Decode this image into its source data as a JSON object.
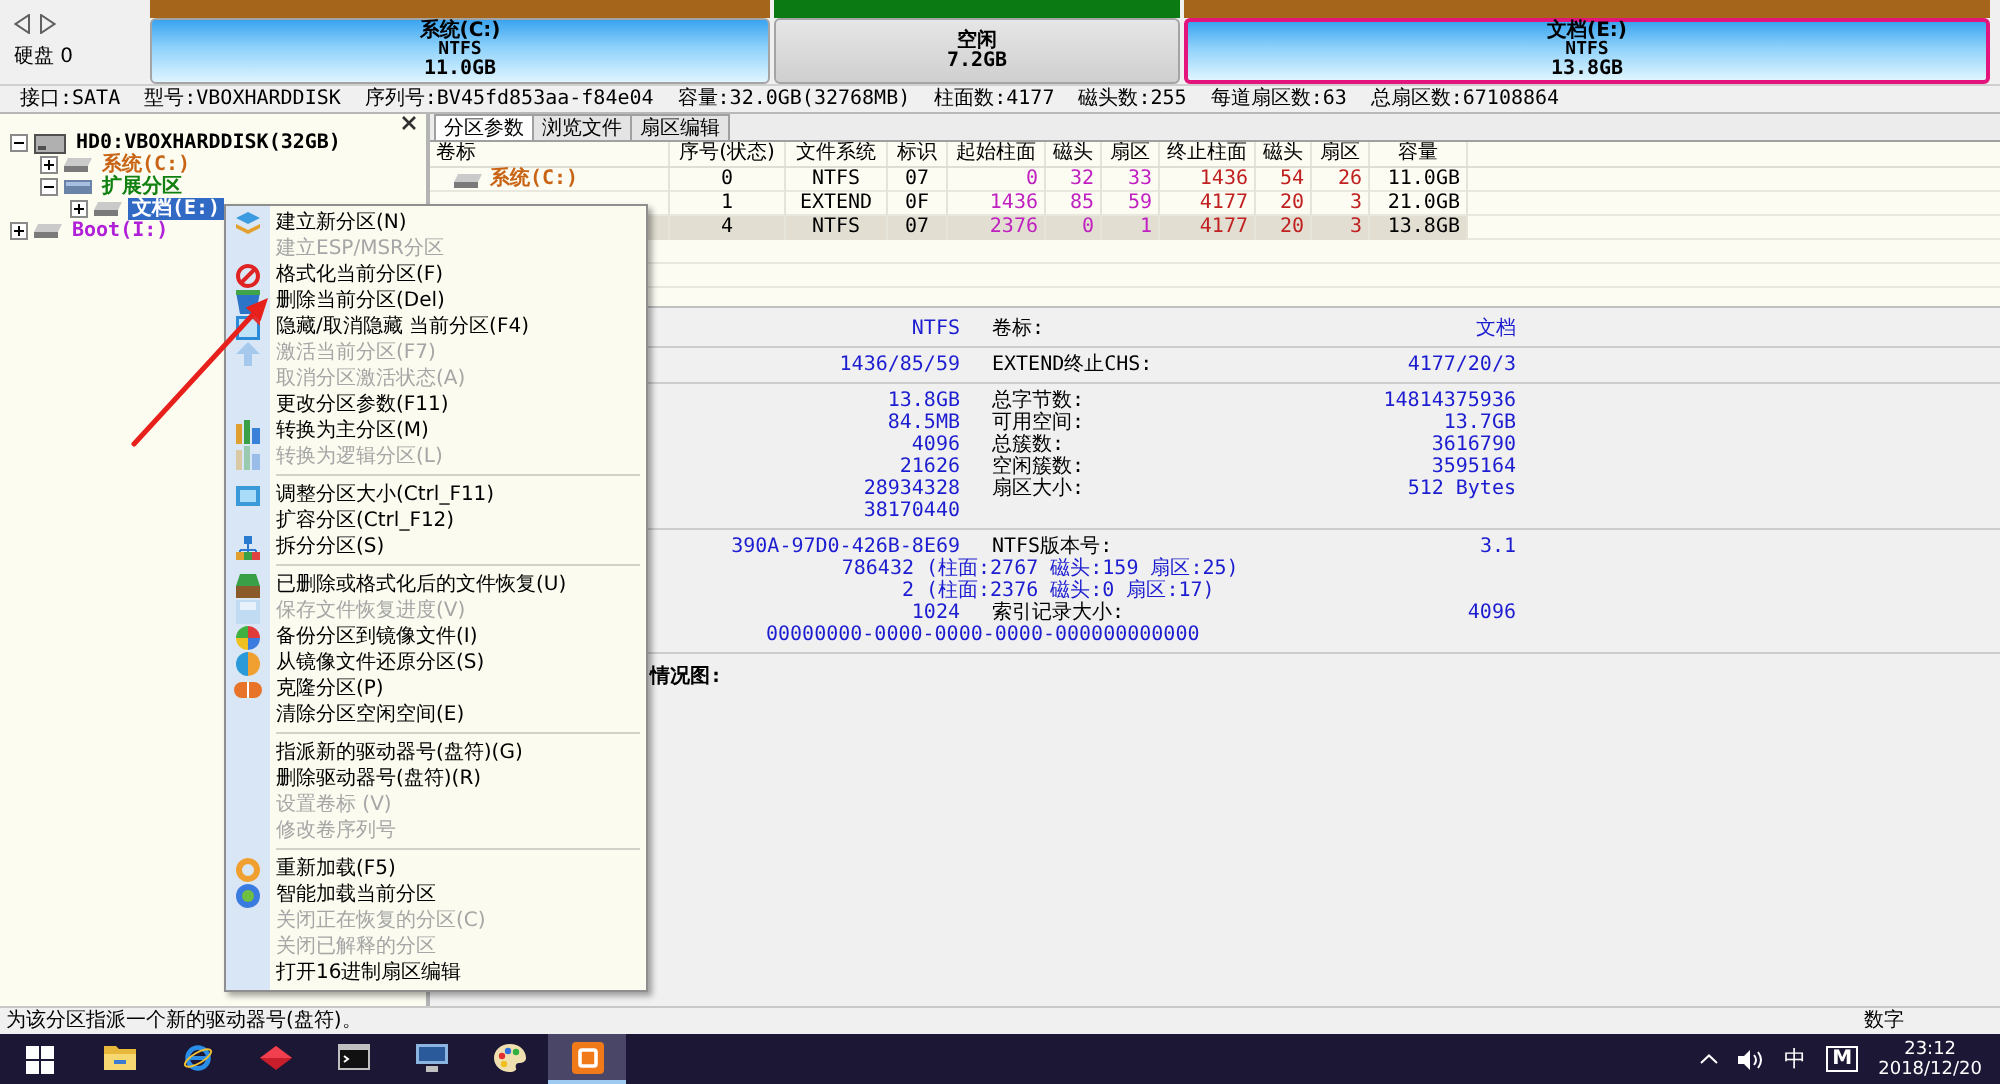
{
  "disk_nav": {
    "label": "硬盘 0"
  },
  "disk_map": [
    {
      "kind": "partition",
      "name": "系统(C:)",
      "filesystem": "NTFS",
      "size": "11.0GB",
      "selected": false
    },
    {
      "kind": "free",
      "name": "空闲",
      "size": "7.2GB",
      "selected": false
    },
    {
      "kind": "partition",
      "name": "文档(E:)",
      "filesystem": "NTFS",
      "size": "13.8GB",
      "selected": true
    }
  ],
  "disk_info": [
    "接口:SATA",
    "型号:VBOXHARDDISK",
    "序列号:BV45fd853aa-f84e04",
    "容量:32.0GB(32768MB)",
    "柱面数:4177",
    "磁头数:255",
    "每道扇区数:63",
    "总扇区数:67108864"
  ],
  "tree": [
    {
      "kind": "disk",
      "label": "HD0:VBOXHARDDISK(32GB)",
      "expanded": true,
      "selected": false,
      "children": [
        {
          "kind": "partition",
          "label": "系统(C:)",
          "color": "#c86414",
          "expanded": false,
          "selected": false
        },
        {
          "kind": "extended",
          "label": "扩展分区",
          "color": "#108010",
          "expanded": true,
          "selected": false,
          "children": [
            {
              "kind": "partition",
              "label": "文档(E:)",
              "expanded": false,
              "selected": true
            }
          ]
        }
      ]
    },
    {
      "kind": "partition",
      "label": "Boot(I:)",
      "color": "#b020d8",
      "expanded": false,
      "selected": false
    }
  ],
  "tabs": [
    {
      "label": "分区参数",
      "selected": true
    },
    {
      "label": "浏览文件",
      "selected": false
    },
    {
      "label": "扇区编辑",
      "selected": false
    }
  ],
  "table": {
    "columns": [
      "卷标",
      "序号(状态)",
      "文件系统",
      "标识",
      "起始柱面",
      "磁头",
      "扇区",
      "终止柱面",
      "磁头",
      "扇区",
      "容量"
    ],
    "rows": [
      {
        "color": "#c86414",
        "selected": false,
        "cells": [
          "系统(C:)",
          "0",
          "NTFS",
          "07",
          "0",
          "32",
          "33",
          "1436",
          "54",
          "26",
          "11.0GB"
        ]
      },
      {
        "selected": false,
        "cells": [
          "",
          "1",
          "EXTEND",
          "0F",
          "1436",
          "85",
          "59",
          "4177",
          "20",
          "3",
          "21.0GB"
        ]
      },
      {
        "selected": true,
        "cells": [
          "",
          "4",
          "NTFS",
          "07",
          "2376",
          "0",
          "1",
          "4177",
          "20",
          "3",
          "13.8GB"
        ]
      }
    ]
  },
  "details": {
    "groups": [
      [
        {
          "kind": "pair",
          "value": "NTFS",
          "label": "卷标:",
          "label_value": "文档"
        }
      ],
      [
        {
          "kind": "pair",
          "value": "1436/85/59",
          "label": "EXTEND终止CHS:",
          "label_value": "4177/20/3"
        }
      ],
      [
        {
          "kind": "pair",
          "value": "13.8GB",
          "label": "总字节数:",
          "label_value": "14814375936"
        },
        {
          "kind": "pair",
          "value": "84.5MB",
          "label": "可用空间:",
          "label_value": "13.7GB"
        },
        {
          "kind": "pair",
          "value": "4096",
          "label": "总簇数:",
          "label_value": "3616790"
        },
        {
          "kind": "pair",
          "value": "21626",
          "label": "空闲簇数:",
          "label_value": "3595164"
        },
        {
          "kind": "pair",
          "value": "28934328",
          "label": "扇区大小:",
          "label_value": "512 Bytes"
        },
        {
          "kind": "value",
          "value": "38170440"
        }
      ],
      [
        {
          "kind": "pair",
          "value": "390A-97D0-426B-8E69",
          "label": "NTFS版本号:",
          "label_value": "3.1"
        },
        {
          "kind": "split",
          "value": "786432",
          "extra": "(柱面:2767 磁头:159 扇区:25)"
        },
        {
          "kind": "split",
          "value": "2",
          "extra": "(柱面:2376 磁头:0 扇区:17)"
        },
        {
          "kind": "pair",
          "value": "1024",
          "label": "索引记录大小:",
          "label_value": "4096"
        },
        {
          "kind": "wide",
          "value": "00000000-0000-0000-0000-000000000000"
        }
      ]
    ],
    "map_label": "情况图:"
  },
  "menu": [
    {
      "kind": "item",
      "label": "建立新分区(N)",
      "disabled": false
    },
    {
      "kind": "item",
      "label": "建立ESP/MSR分区",
      "disabled": true
    },
    {
      "kind": "item",
      "label": "格式化当前分区(F)",
      "disabled": false
    },
    {
      "kind": "item",
      "label": "删除当前分区(Del)",
      "disabled": false
    },
    {
      "kind": "item",
      "label": "隐藏/取消隐藏 当前分区(F4)",
      "disabled": false
    },
    {
      "kind": "item",
      "label": "激活当前分区(F7)",
      "disabled": true
    },
    {
      "kind": "item",
      "label": "取消分区激活状态(A)",
      "disabled": true
    },
    {
      "kind": "item",
      "label": "更改分区参数(F11)",
      "disabled": false
    },
    {
      "kind": "item",
      "label": "转换为主分区(M)",
      "disabled": false
    },
    {
      "kind": "item",
      "label": "转换为逻辑分区(L)",
      "disabled": true
    },
    {
      "kind": "separator"
    },
    {
      "kind": "item",
      "label": "调整分区大小(Ctrl_F11)",
      "disabled": false
    },
    {
      "kind": "item",
      "label": "扩容分区(Ctrl_F12)",
      "disabled": false
    },
    {
      "kind": "item",
      "label": "拆分分区(S)",
      "disabled": false
    },
    {
      "kind": "separator"
    },
    {
      "kind": "item",
      "label": "已删除或格式化后的文件恢复(U)",
      "disabled": false
    },
    {
      "kind": "item",
      "label": "保存文件恢复进度(V)",
      "disabled": true
    },
    {
      "kind": "item",
      "label": "备份分区到镜像文件(I)",
      "disabled": false
    },
    {
      "kind": "item",
      "label": "从镜像文件还原分区(S)",
      "disabled": false
    },
    {
      "kind": "item",
      "label": "克隆分区(P)",
      "disabled": false
    },
    {
      "kind": "item",
      "label": "清除分区空闲空间(E)",
      "disabled": false
    },
    {
      "kind": "separator"
    },
    {
      "kind": "item",
      "label": "指派新的驱动器号(盘符)(G)",
      "disabled": false
    },
    {
      "kind": "item",
      "label": "删除驱动器号(盘符)(R)",
      "disabled": false
    },
    {
      "kind": "item",
      "label": "设置卷标 (V)",
      "disabled": true
    },
    {
      "kind": "item",
      "label": "修改卷序列号",
      "disabled": true
    },
    {
      "kind": "separator"
    },
    {
      "kind": "item",
      "label": "重新加载(F5)",
      "disabled": false
    },
    {
      "kind": "item",
      "label": "智能加载当前分区",
      "disabled": false
    },
    {
      "kind": "item",
      "label": "关闭正在恢复的分区(C)",
      "disabled": true
    },
    {
      "kind": "item",
      "label": "关闭已解释的分区",
      "disabled": true
    },
    {
      "kind": "item",
      "label": "打开16进制扇区编辑",
      "disabled": false
    }
  ],
  "status_bar": {
    "message": "为该分区指派一个新的驱动器号(盘符)。",
    "indicator": "数字"
  },
  "taskbar": {
    "apps": [
      {
        "selected": false
      },
      {
        "selected": false
      },
      {
        "selected": false
      },
      {
        "selected": false
      },
      {
        "selected": false
      },
      {
        "selected": false
      },
      {
        "selected": true
      }
    ],
    "ime": "中",
    "input_mode": "M",
    "time": "23:12",
    "date": "2018/12/20"
  }
}
